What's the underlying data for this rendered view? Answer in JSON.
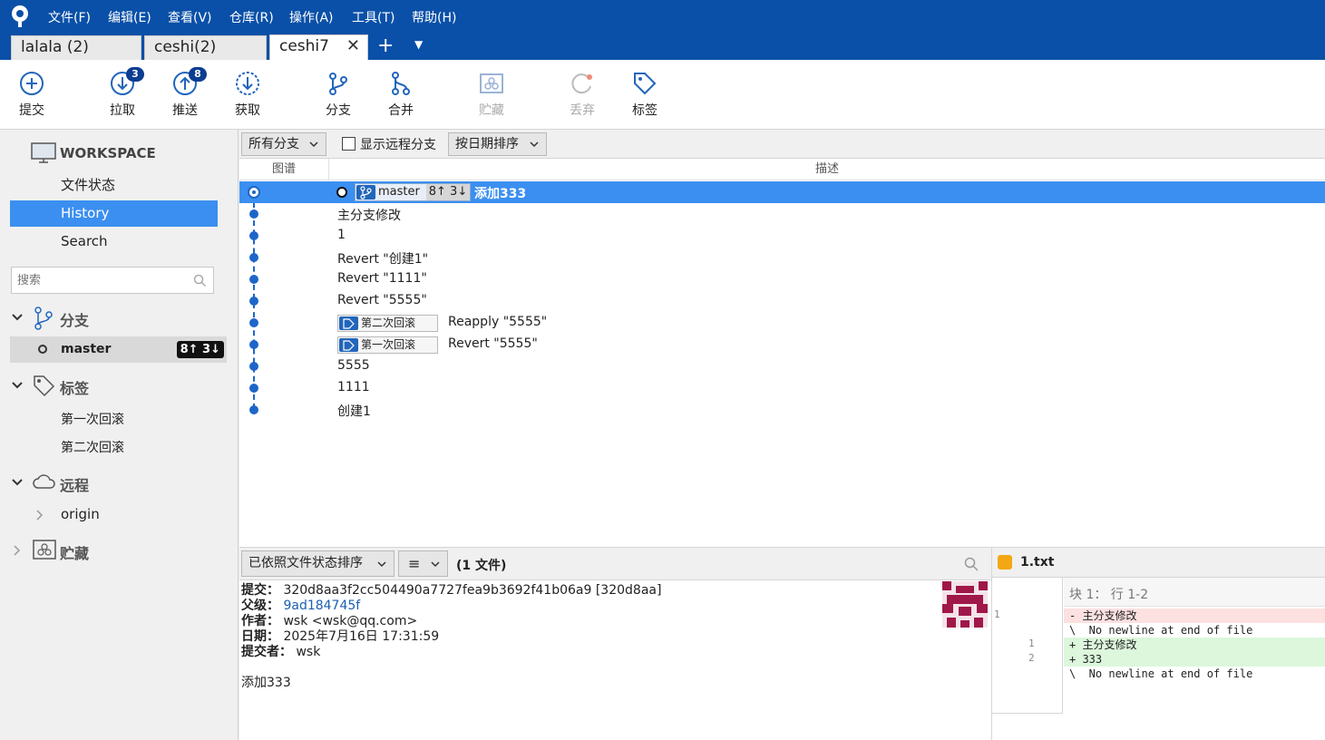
{
  "menu": [
    "文件(F)",
    "编辑(E)",
    "查看(V)",
    "仓库(R)",
    "操作(A)",
    "工具(T)",
    "帮助(H)"
  ],
  "tabs": [
    {
      "label": "lalala (2)"
    },
    {
      "label": "ceshi(2)"
    },
    {
      "label": "ceshi7",
      "close": "✕"
    }
  ],
  "tab_add": "+",
  "toolbar": {
    "commit": "提交",
    "pull": "拉取",
    "pull_badge": "3",
    "push": "推送",
    "push_badge": "8",
    "fetch": "获取",
    "branch": "分支",
    "merge": "合并",
    "stash": "贮藏",
    "discard": "丢弃",
    "tag": "标签"
  },
  "sidebar": {
    "workspace_title": "WORKSPACE",
    "nav": [
      "文件状态",
      "History",
      "Search"
    ],
    "search_placeholder": "搜索",
    "branches_header": "分支",
    "branch_name": "master",
    "branch_ahead_behind": "8↑ 3↓",
    "tags_header": "标签",
    "tags": [
      "第一次回滚",
      "第二次回滚"
    ],
    "remotes_header": "远程",
    "remote": "origin",
    "stash_header": "贮藏"
  },
  "filter": {
    "branch_dropdown": "所有分支",
    "show_remote": "显示远程分支",
    "sort_dropdown": "按日期排序"
  },
  "columns": {
    "graph": "图谱",
    "description": "描述"
  },
  "commits": [
    {
      "desc": "添加333",
      "ref": "master",
      "ref_ab": "8↑ 3↓"
    },
    {
      "desc": "主分支修改"
    },
    {
      "desc": "1"
    },
    {
      "desc": "Revert \"创建1\""
    },
    {
      "desc": "Revert \"1111\""
    },
    {
      "desc": "Revert \"5555\""
    },
    {
      "desc": "Reapply \"5555\"",
      "tag": "第二次回滚"
    },
    {
      "desc": "Revert \"5555\"",
      "tag": "第一次回滚"
    },
    {
      "desc": "5555"
    },
    {
      "desc": "1111"
    },
    {
      "desc": "创建1"
    }
  ],
  "files_bar": {
    "sort_dropdown": "已依照文件状态排序",
    "view_icon": "≡",
    "count": "(1 文件)"
  },
  "details": {
    "commit_label": "提交：",
    "commit_value": "320d8aa3f2cc504490a7727fea9b3692f41b06a9 [320d8aa]",
    "parent_label": "父级：",
    "parent_value": "9ad184745f",
    "author_label": "作者：",
    "author_value": "wsk <wsk@qq.com>",
    "date_label": "日期：",
    "date_value": "2025年7月16日 17:31:59",
    "committer_label": "提交者：",
    "committer_value": "wsk",
    "message": "添加333"
  },
  "diff": {
    "file": "1.txt",
    "hunk": "块 1： 行 1-2",
    "left_nums": [
      "1"
    ],
    "right_nums": [
      "1",
      "2"
    ],
    "lines": [
      {
        "type": "del",
        "text": "- 主分支修改"
      },
      {
        "type": "ctx",
        "text": "\\  No newline at end of file"
      },
      {
        "type": "add",
        "text": "+ 主分支修改"
      },
      {
        "type": "add",
        "text": "+ 333"
      },
      {
        "type": "ctx",
        "text": "\\  No newline at end of file"
      }
    ]
  },
  "colors": {
    "menubar": "#0a50a8",
    "selection": "#3b8ff0",
    "graph": "#1d66c9",
    "badge": "#0b3d91"
  }
}
